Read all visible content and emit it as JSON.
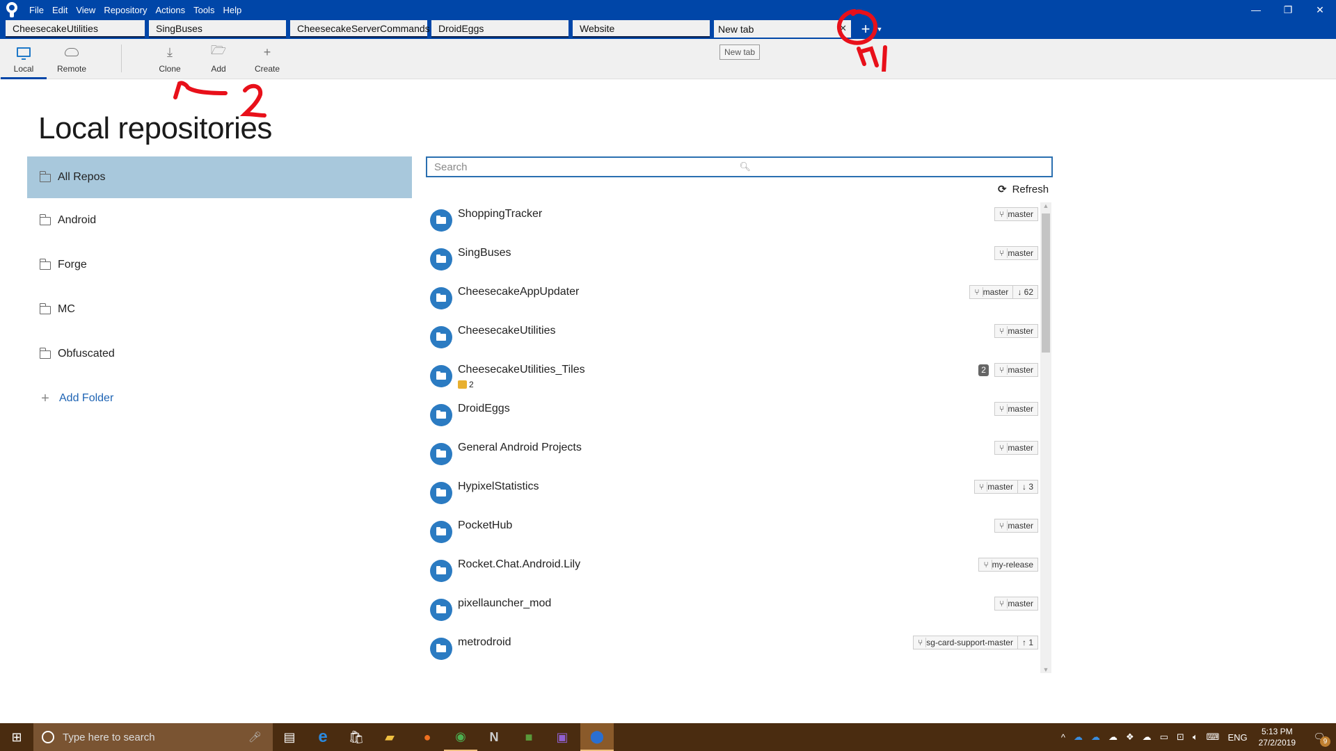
{
  "app": {
    "menu": [
      "File",
      "Edit",
      "View",
      "Repository",
      "Actions",
      "Tools",
      "Help"
    ],
    "window_buttons": {
      "minimize": "—",
      "restore": "❐",
      "close": "✕"
    }
  },
  "tabs": [
    {
      "label": "CheesecakeUtilities",
      "active": false
    },
    {
      "label": "SingBuses",
      "active": false
    },
    {
      "label": "CheesecakeServerCommands",
      "active": false
    },
    {
      "label": "DroidEggs",
      "active": false
    },
    {
      "label": "Website",
      "active": false
    },
    {
      "label": "New tab",
      "active": true
    }
  ],
  "tab_close": "✕",
  "tab_add": "+",
  "tab_dropdown": "▼",
  "tooltip": "New tab",
  "toolbar": {
    "local": "Local",
    "remote": "Remote",
    "clone": "Clone",
    "add": "Add",
    "create": "Create"
  },
  "page_title": "Local repositories",
  "sidebar": {
    "items": [
      {
        "label": "All Repos",
        "selected": true
      },
      {
        "label": "Android"
      },
      {
        "label": "Forge"
      },
      {
        "label": "MC"
      },
      {
        "label": "Obfuscated"
      }
    ],
    "add_folder": "Add Folder"
  },
  "search": {
    "placeholder": "Search"
  },
  "refresh_label": "Refresh",
  "repos": [
    {
      "name": "ShoppingTracker",
      "branch": "master"
    },
    {
      "name": "SingBuses",
      "branch": "master"
    },
    {
      "name": "CheesecakeAppUpdater",
      "branch": "master",
      "behind": "↓ 62"
    },
    {
      "name": "CheesecakeUtilities",
      "branch": "master"
    },
    {
      "name": "CheesecakeUtilities_Tiles",
      "branch": "master",
      "count": "2",
      "stashes": "2"
    },
    {
      "name": "DroidEggs",
      "branch": "master"
    },
    {
      "name": "General Android Projects",
      "branch": "master"
    },
    {
      "name": "HypixelStatistics",
      "branch": "master",
      "behind": "↓ 3"
    },
    {
      "name": "PocketHub",
      "branch": "master"
    },
    {
      "name": "Rocket.Chat.Android.Lily",
      "branch": "my-release"
    },
    {
      "name": "pixellauncher_mod",
      "branch": "master"
    },
    {
      "name": "metrodroid",
      "branch": "sg-card-support-master",
      "ahead": "↑ 1"
    }
  ],
  "taskbar": {
    "search_placeholder": "Type here to search",
    "lang": "ENG",
    "time": "5:13 PM",
    "date": "27/2/2019",
    "notifications": "9"
  },
  "annotations": {
    "one": "1",
    "two": "2"
  },
  "colors": {
    "accent": "#0046a8",
    "selection": "#a8c8dc",
    "repo_icon": "#2b7bc2",
    "annotation": "#e8101a"
  }
}
